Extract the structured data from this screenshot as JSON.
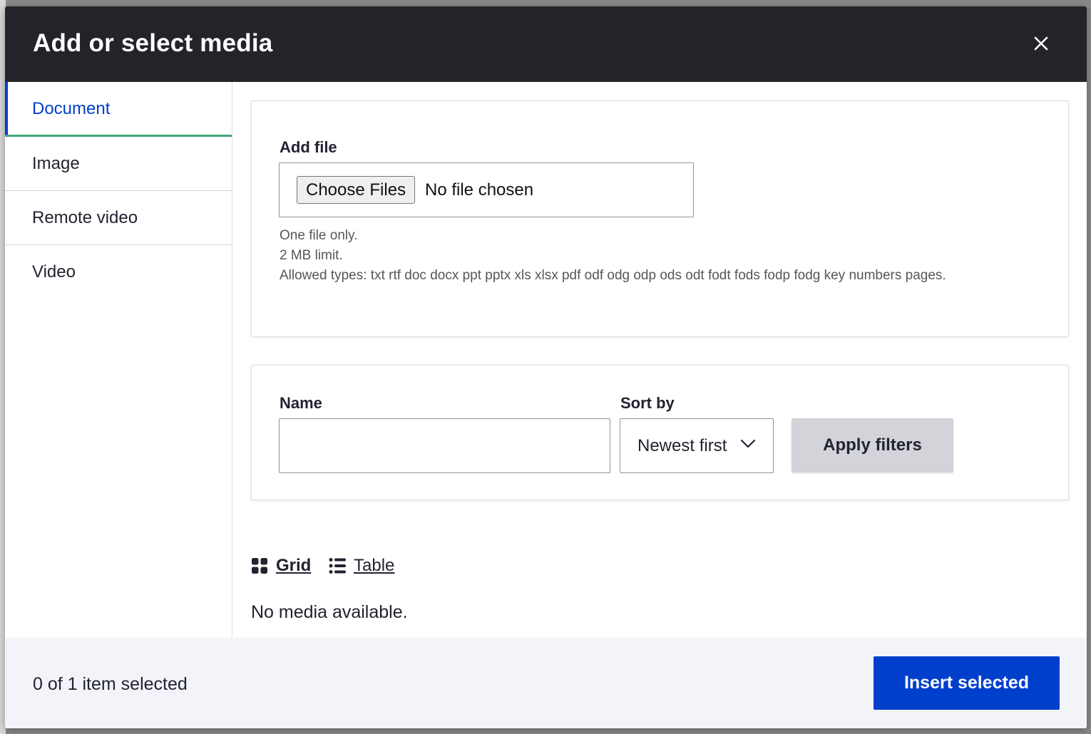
{
  "dialog": {
    "title": "Add or select media",
    "close_icon": "close-icon"
  },
  "sidebar": {
    "tabs": [
      {
        "label": "Document",
        "active": true
      },
      {
        "label": "Image",
        "active": false
      },
      {
        "label": "Remote video",
        "active": false
      },
      {
        "label": "Video",
        "active": false
      }
    ]
  },
  "upload": {
    "label": "Add file",
    "choose_button": "Choose Files",
    "file_status": "No file chosen",
    "help_lines": [
      "One file only.",
      "2 MB limit.",
      "Allowed types: txt rtf doc docx ppt pptx xls xlsx pdf odf odg odp ods odt fodt fods fodp fodg key numbers pages."
    ]
  },
  "filters": {
    "name_label": "Name",
    "name_value": "",
    "sort_label": "Sort by",
    "sort_value": "Newest first",
    "apply_button": "Apply filters"
  },
  "views": {
    "grid_label": "Grid",
    "grid_icon": "grid-icon",
    "table_label": "Table",
    "table_icon": "list-icon"
  },
  "results": {
    "empty_message": "No media available."
  },
  "footer": {
    "selected_count": "0 of 1 item selected",
    "insert_button": "Insert selected"
  },
  "colors": {
    "titlebar": "#232429",
    "accent_blue": "#003ecc",
    "active_tab_underline": "#42a877",
    "footer_bg": "#f3f4f9",
    "apply_button_bg": "#d3d4d9"
  }
}
